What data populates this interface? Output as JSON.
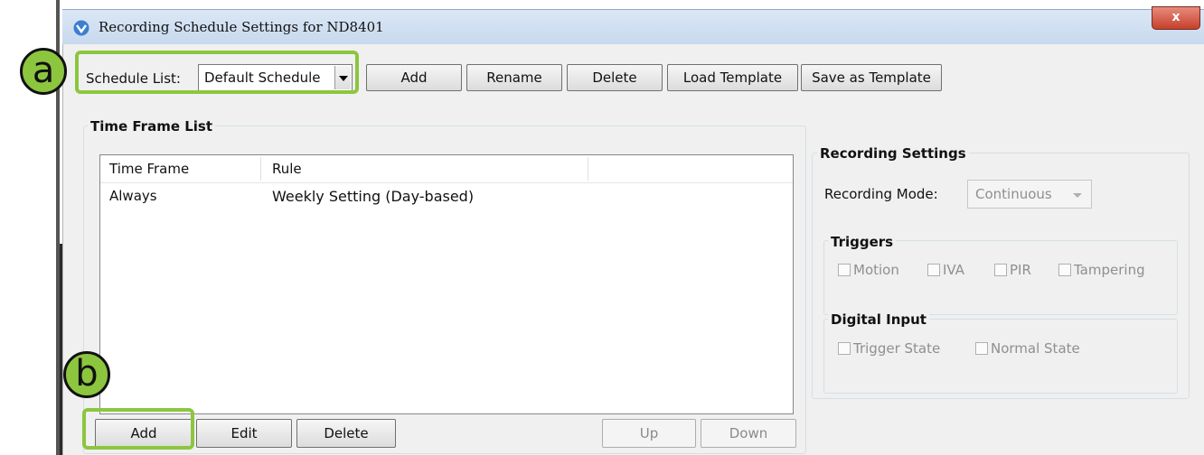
{
  "window": {
    "title": "Recording Schedule Settings for ND8401",
    "close_label": "x"
  },
  "toolbar": {
    "schedule_label": "Schedule List:",
    "schedule_value": "Default Schedule",
    "add": "Add",
    "rename": "Rename",
    "delete": "Delete",
    "load_template": "Load Template",
    "save_template": "Save as Template"
  },
  "time_frame": {
    "group_title": "Time Frame List",
    "columns": [
      "Time Frame",
      "Rule"
    ],
    "rows": [
      {
        "time_frame": "Always",
        "rule": "Weekly Setting (Day-based)"
      }
    ],
    "add": "Add",
    "edit": "Edit",
    "delete": "Delete",
    "up": "Up",
    "down": "Down"
  },
  "recording": {
    "group_title": "Recording Settings",
    "mode_label": "Recording Mode:",
    "mode_value": "Continuous",
    "triggers_title": "Triggers",
    "triggers": [
      "Motion",
      "IVA",
      "PIR",
      "Tampering"
    ],
    "digital_title": "Digital Input",
    "digital": [
      "Trigger State",
      "Normal State"
    ]
  },
  "callouts": {
    "a": "a",
    "b": "b",
    "accent": "#8cc63f"
  }
}
